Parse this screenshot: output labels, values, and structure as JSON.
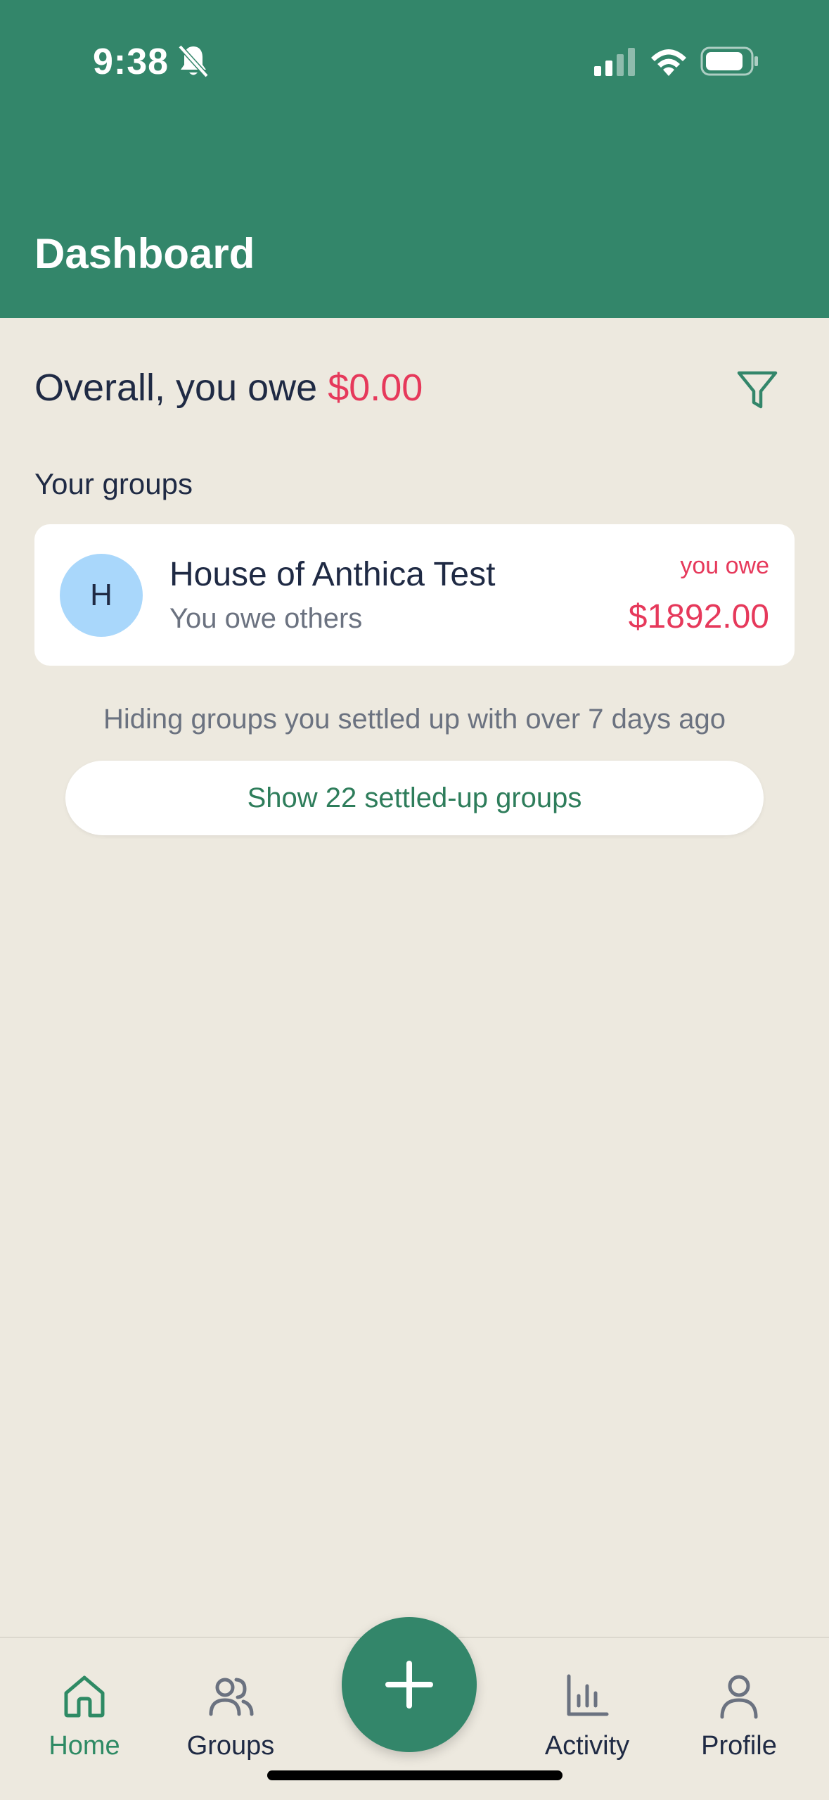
{
  "status_bar": {
    "time": "9:38"
  },
  "header": {
    "title": "Dashboard"
  },
  "summary": {
    "prefix": "Overall, you owe",
    "amount": "$0.00"
  },
  "groups_section": {
    "label": "Your groups",
    "items": [
      {
        "avatar_letter": "H",
        "name": "House of Anthica Test",
        "subtitle": "You owe others",
        "status_label": "you owe",
        "amount": "$1892.00"
      }
    ]
  },
  "hidden_note": "Hiding groups you settled up with over 7 days ago",
  "show_settled_button": "Show 22 settled-up groups",
  "tabbar": {
    "items": [
      {
        "label": "Home",
        "icon": "home-icon"
      },
      {
        "label": "Groups",
        "icon": "users-icon"
      },
      {
        "label": "Activity",
        "icon": "bar-chart-icon"
      },
      {
        "label": "Profile",
        "icon": "user-icon"
      }
    ],
    "fab_icon": "plus-icon"
  },
  "colors": {
    "brand_green": "#33866A",
    "owe_red": "#E6395B",
    "background": "#EDE9DF",
    "avatar_blue": "#A9D7FB"
  }
}
